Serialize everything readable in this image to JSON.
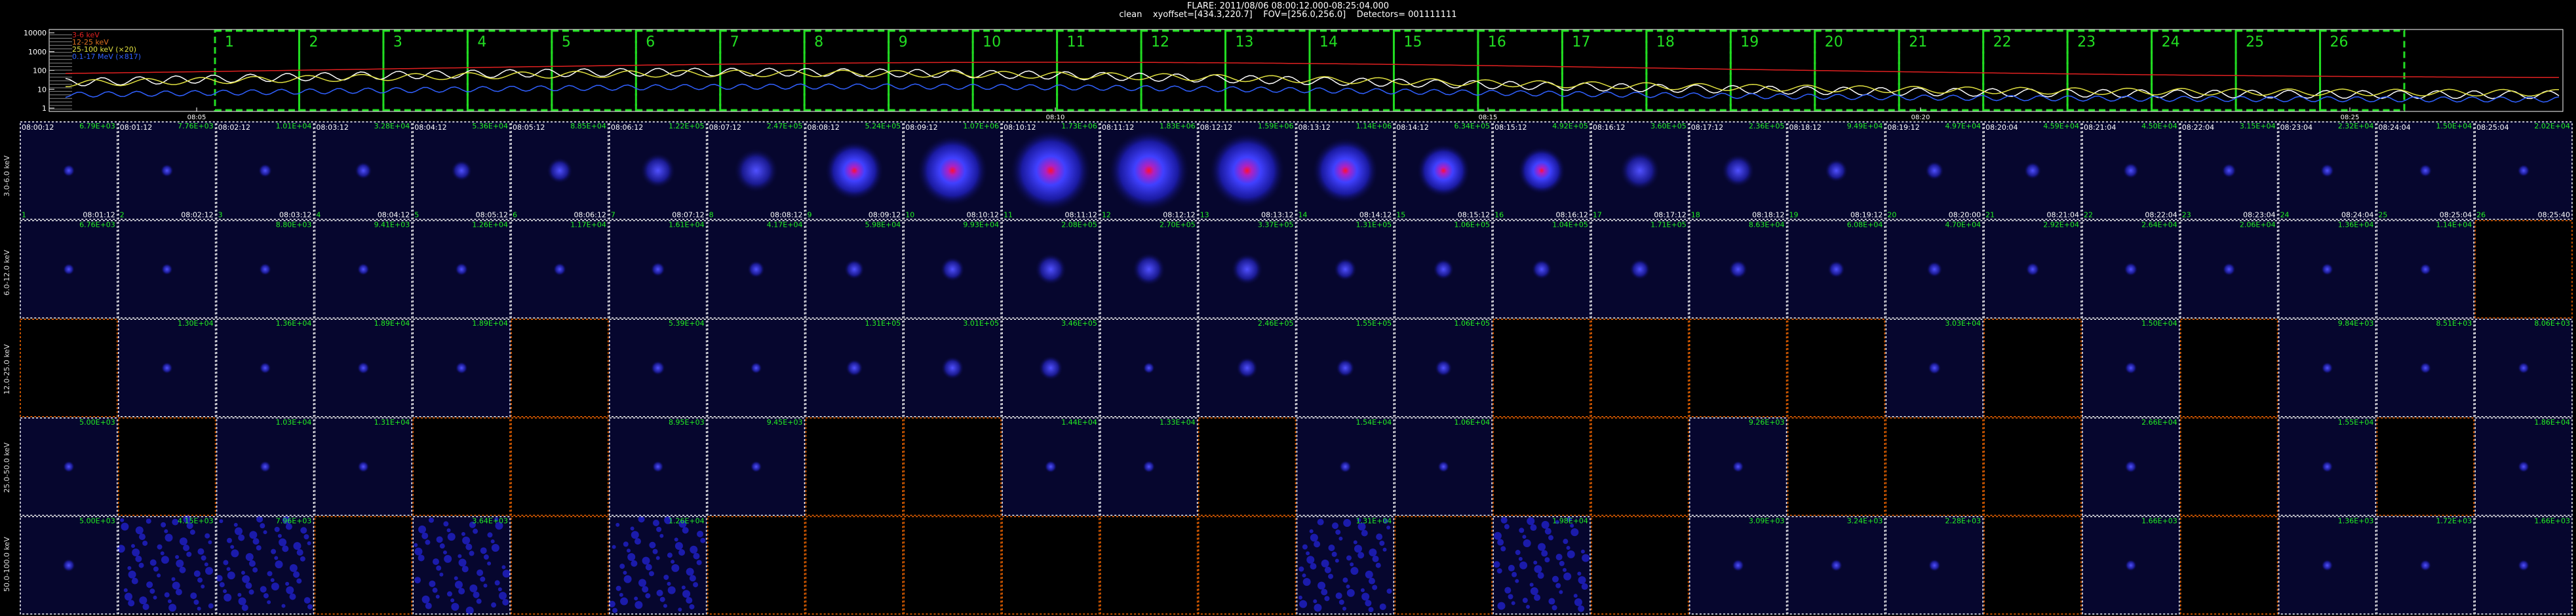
{
  "header": {
    "title": "FLARE: 2011/08/06 08:00:12.000-08:25:04.000",
    "subtitle": "clean    xyoffset=[434.3,220.7]    FOV=[256.0,256.0]    Detectors= 001111111"
  },
  "lightcurve": {
    "y_ticks": [
      "10000",
      "1000",
      "100",
      "10",
      "1"
    ],
    "x_ticks": [
      "08:05",
      "08:10",
      "08:15",
      "08:20",
      "08:25"
    ],
    "legend": [
      {
        "label": "3-6 keV",
        "color": "#e02020"
      },
      {
        "label": "12-25 keV",
        "color": "#e07020"
      },
      {
        "label": "25-100 keV (×20)",
        "color": "#e0e040"
      },
      {
        "label": "0.1-17 MeV (×817)",
        "color": "#3060ff"
      }
    ],
    "interval_numbers": [
      "1",
      "2",
      "3",
      "4",
      "5",
      "6",
      "7",
      "8",
      "9",
      "10",
      "11",
      "12",
      "13",
      "14",
      "15",
      "16",
      "17",
      "18",
      "19",
      "20",
      "21",
      "22",
      "23",
      "24",
      "25",
      "26"
    ],
    "interval_box_color": "#22dd22"
  },
  "grid": {
    "start_labels": [
      "08:00:12",
      "08:01:12",
      "08:02:12",
      "08:03:12",
      "08:04:12",
      "08:05:12",
      "08:06:12",
      "08:07:12",
      "08:08:12",
      "08:09:12",
      "08:10:12",
      "08:11:12",
      "08:12:12",
      "08:13:12",
      "08:14:12",
      "08:15:12",
      "08:16:12",
      "08:17:12",
      "08:18:12",
      "08:19:12",
      "08:20:04",
      "08:21:04",
      "08:22:04",
      "08:23:04",
      "08:24:04",
      "08:25:04"
    ],
    "end_labels": [
      "08:01:12",
      "08:02:12",
      "08:03:12",
      "08:04:12",
      "08:05:12",
      "08:06:12",
      "08:07:12",
      "08:08:12",
      "08:09:12",
      "08:10:12",
      "08:11:12",
      "08:12:12",
      "08:13:12",
      "08:14:12",
      "08:15:12",
      "08:16:12",
      "08:17:12",
      "08:18:12",
      "08:19:12",
      "08:20:00",
      "08:21:04",
      "08:22:04",
      "08:23:04",
      "08:24:04",
      "08:25:04",
      "08:25:40"
    ],
    "rows": [
      {
        "energy": "3.0-6.0 keV",
        "peaks": [
          "6.79E+03",
          "7.76E+03",
          "1.01E+04",
          "3.28E+04",
          "5.36E+04",
          "8.85E+04",
          "1.22E+05",
          "2.47E+05",
          "5.24E+05",
          "1.07E+06",
          "1.73E+06",
          "1.83E+06",
          "1.59E+06",
          "1.14E+06",
          "6.34E+05",
          "4.92E+05",
          "3.60E+05",
          "2.36E+05",
          "9.49E+04",
          "4.97E+04",
          "4.59E+04",
          "4.50E+04",
          "3.15E+04",
          "2.32E+04",
          "1.50E+04",
          "2.02E+04"
        ],
        "intensity": [
          0.03,
          0.04,
          0.05,
          0.1,
          0.15,
          0.22,
          0.35,
          0.48,
          0.68,
          0.85,
          1.0,
          1.0,
          0.92,
          0.78,
          0.6,
          0.52,
          0.42,
          0.32,
          0.18,
          0.12,
          0.1,
          0.08,
          0.06,
          0.05,
          0.04,
          0.03
        ],
        "empty": []
      },
      {
        "energy": "6.0-12.0 keV",
        "peaks": [
          "6.76E+03",
          "",
          "8.80E+03",
          "9.41E+03",
          "1.26E+04",
          "1.17E+04",
          "1.61E+04",
          "4.17E+04",
          "5.98E+04",
          "9.93E+04",
          "2.08E+05",
          "2.70E+05",
          "3.37E+05",
          "1.31E+05",
          "1.06E+05",
          "1.04E+05",
          "1.71E+05",
          "8.63E+04",
          "6.08E+04",
          "4.70E+04",
          "2.92E+04",
          "2.64E+04",
          "2.06E+04",
          "1.36E+04",
          "1.14E+04",
          ""
        ],
        "intensity": [
          0.02,
          0.02,
          0.03,
          0.03,
          0.04,
          0.04,
          0.06,
          0.1,
          0.14,
          0.2,
          0.3,
          0.32,
          0.3,
          0.18,
          0.15,
          0.14,
          0.15,
          0.12,
          0.1,
          0.08,
          0.05,
          0.05,
          0.04,
          0.03,
          0.02,
          0
        ],
        "empty": [
          25
        ]
      },
      {
        "energy": "12.0-25.0 keV",
        "peaks": [
          "",
          "1.30E+04",
          "1.36E+04",
          "1.89E+04",
          "1.89E+04",
          "",
          "5.39E+04",
          "",
          "1.31E+05",
          "3.01E+05",
          "3.46E+05",
          "",
          "2.46E+05",
          "1.55E+05",
          "1.06E+05",
          "",
          "",
          "",
          "",
          "3.03E+04",
          "",
          "1.50E+04",
          "",
          "9.84E+03",
          "8.51E+03",
          "8.06E+03"
        ],
        "intensity": [
          0,
          0.02,
          0.02,
          0.03,
          0.03,
          0,
          0.06,
          0.02,
          0.1,
          0.18,
          0.2,
          0.02,
          0.16,
          0.12,
          0.1,
          0,
          0,
          0,
          0,
          0.04,
          0,
          0.03,
          0,
          0.02,
          0.02,
          0.02
        ],
        "empty": [
          0,
          5,
          15,
          16,
          17,
          18,
          20,
          22
        ]
      },
      {
        "energy": "25.0-50.0 keV",
        "peaks": [
          "5.00E+03",
          "",
          "1.03E+04",
          "1.31E+04",
          "",
          "",
          "8.95E+03",
          "9.45E+03",
          "",
          "",
          "1.44E+04",
          "1.33E+04",
          "",
          "1.54E+04",
          "1.06E+04",
          "",
          "",
          "9.26E+03",
          "",
          "",
          "",
          "2.66E+04",
          "",
          "1.55E+04",
          "",
          "1.86E+04"
        ],
        "intensity": [
          0.02,
          0,
          0.02,
          0.02,
          0,
          0,
          0.02,
          0.02,
          0,
          0,
          0.03,
          0.03,
          0,
          0.03,
          0.02,
          0,
          0,
          0.02,
          0,
          0,
          0,
          0.03,
          0,
          0.02,
          0,
          0.02
        ],
        "empty": [
          1,
          4,
          5,
          8,
          9,
          12,
          15,
          16,
          18,
          19,
          20,
          22,
          24
        ]
      },
      {
        "energy": "50.0-100.0 keV",
        "peaks": [
          "5.00E+03",
          "4.15E+03",
          "7.96E+03",
          "",
          "3.64E+03",
          "",
          "1.26E+04",
          "",
          "",
          "",
          "",
          "",
          "",
          "1.31E+04",
          "",
          "1.98E+04",
          "",
          "3.09E+03",
          "3.24E+03",
          "2.28E+03",
          "",
          "1.66E+03",
          "",
          "1.36E+03",
          "1.72E+03",
          "1.66E+03"
        ],
        "intensity": [
          0.04,
          0.3,
          0.35,
          0,
          0.3,
          0,
          0.15,
          0,
          0,
          0,
          0,
          0,
          0,
          0.25,
          0,
          0.2,
          0,
          0.03,
          0.03,
          0.03,
          0,
          0.02,
          0,
          0.02,
          0.02,
          0.02
        ],
        "empty": [
          3,
          5,
          7,
          8,
          9,
          10,
          11,
          12,
          14,
          16,
          20,
          22
        ]
      }
    ]
  }
}
